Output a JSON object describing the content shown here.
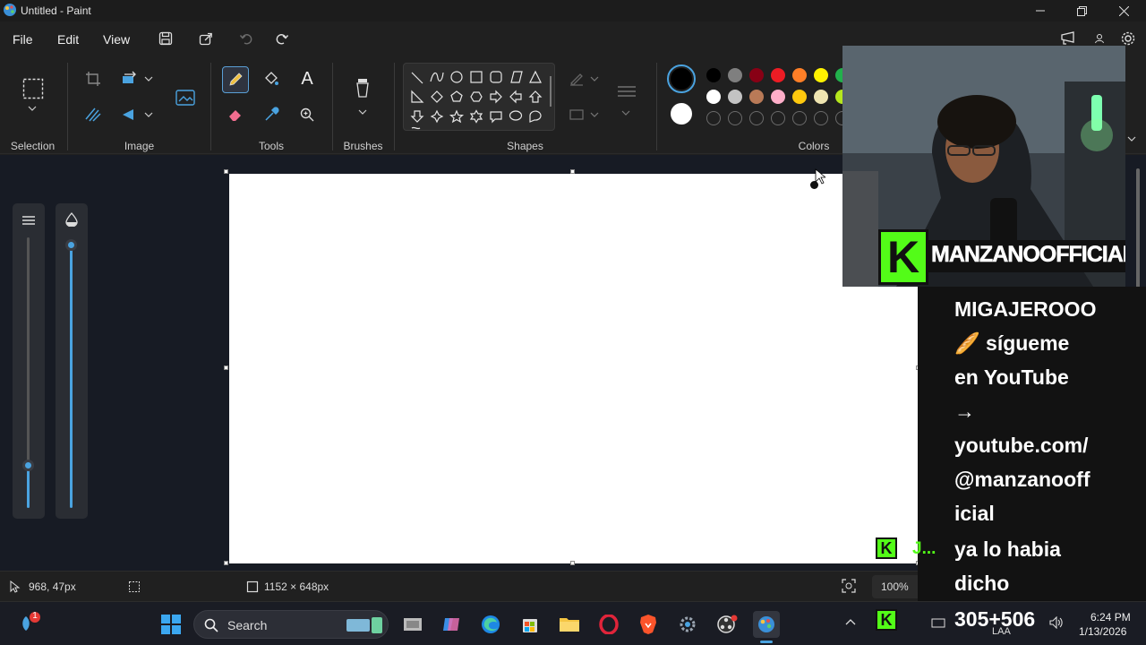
{
  "app": {
    "title": "Untitled - Paint"
  },
  "menu": {
    "file": "File",
    "edit": "Edit",
    "view": "View"
  },
  "ribbon": {
    "groups": {
      "selection": "Selection",
      "image": "Image",
      "tools": "Tools",
      "brushes": "Brushes",
      "shapes": "Shapes",
      "colors": "Colors"
    },
    "text_tool": "A"
  },
  "colors": {
    "primary": "#000000",
    "secondary": "#ffffff",
    "row1": [
      "#000000",
      "#7f7f7f",
      "#880015",
      "#ed1c24",
      "#ff7f27",
      "#fff200",
      "#22b14c"
    ],
    "row2": [
      "#ffffff",
      "#c3c3c3",
      "#b97a57",
      "#ffaec9",
      "#ffc90e",
      "#efe4b0",
      "#b5e61d"
    ]
  },
  "status": {
    "cursor": "968, 47px",
    "canvas_size": "1152 × 648px",
    "zoom": "100%"
  },
  "taskbar": {
    "search": "Search",
    "time": "6:24 PM",
    "date": "1/13/2026",
    "lang": "LAA",
    "notif_count": "1"
  },
  "overlay": {
    "channel": "MANZANOOFFICIAL",
    "logo": "K",
    "chat": {
      "line1": "MIGAJEROOO",
      "line2": "🥖 sígueme",
      "line3": "en YouTube",
      "line4": "→",
      "line5": "youtube.com/",
      "line6": "@manzanooff",
      "line7": "icial",
      "line8": "ya lo habia",
      "line9": "dicho",
      "username": "J...",
      "counter": "305+506"
    }
  }
}
